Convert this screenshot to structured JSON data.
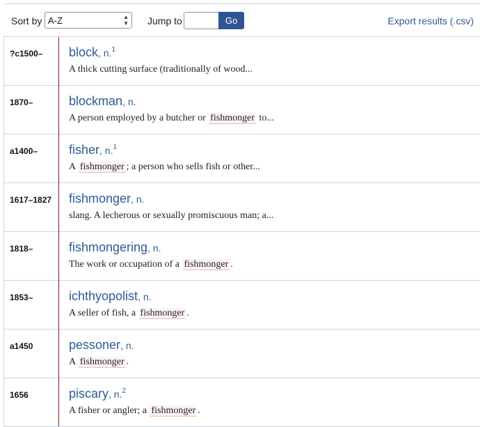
{
  "toolbar": {
    "sort_label": "Sort by",
    "sort_value": "A-Z",
    "jump_label": "Jump to",
    "jump_value": "",
    "go_label": "Go",
    "export_label": "Export results (.csv)"
  },
  "colors": {
    "accent": "#2e5b94",
    "go_button": "#2f5693",
    "date_rule": "#8b1a2a",
    "highlight_bg": "#fdf3f4"
  },
  "results": [
    {
      "date": "?c1500–",
      "headword": "block",
      "pos": ", n.",
      "sup": "1",
      "def": [
        {
          "t": "A thick cutting surface (traditionally of wood..."
        }
      ]
    },
    {
      "date": "1870–",
      "headword": "blockman",
      "pos": ", n.",
      "sup": "",
      "def": [
        {
          "t": "A person employed by a butcher or "
        },
        {
          "t": "fishmonger",
          "hl": true
        },
        {
          "t": " to..."
        }
      ]
    },
    {
      "date": "a1400–",
      "headword": "fisher",
      "pos": ", n.",
      "sup": "1",
      "def": [
        {
          "t": "A "
        },
        {
          "t": "fishmonger",
          "hl": true
        },
        {
          "t": "; a person who sells fish or other..."
        }
      ]
    },
    {
      "date": "1617–1827",
      "headword": "fishmonger",
      "pos": ", n.",
      "sup": "",
      "def": [
        {
          "t": "slang. A lecherous or sexually promiscuous man; a..."
        }
      ]
    },
    {
      "date": "1818–",
      "headword": "fishmongering",
      "pos": ", n.",
      "sup": "",
      "def": [
        {
          "t": "The work or occupation of a "
        },
        {
          "t": "fishmonger",
          "hl": true
        },
        {
          "t": "."
        }
      ]
    },
    {
      "date": "1853–",
      "headword": "ichthyopolist",
      "pos": ", n.",
      "sup": "",
      "def": [
        {
          "t": "A seller of fish, a "
        },
        {
          "t": "fishmonger",
          "hl": true
        },
        {
          "t": "."
        }
      ]
    },
    {
      "date": "a1450",
      "headword": "pessoner",
      "pos": ", n.",
      "sup": "",
      "def": [
        {
          "t": "A "
        },
        {
          "t": "fishmonger",
          "hl": true
        },
        {
          "t": "."
        }
      ]
    },
    {
      "date": "1656",
      "headword": "piscary",
      "pos": ", n.",
      "sup": "2",
      "def": [
        {
          "t": "A fisher or angler; a "
        },
        {
          "t": "fishmonger",
          "hl": true
        },
        {
          "t": "."
        }
      ]
    }
  ]
}
